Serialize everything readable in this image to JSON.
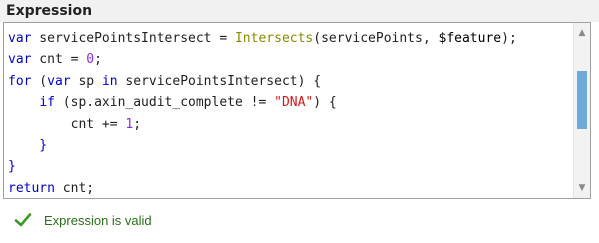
{
  "header": {
    "title": "Expression"
  },
  "editor": {
    "lines": [
      [
        {
          "t": "var",
          "c": "kw"
        },
        {
          "t": " servicePointsIntersect = "
        },
        {
          "t": "Intersects",
          "c": "fn"
        },
        {
          "t": "(servicePoints, "
        },
        {
          "t": "$feature",
          "c": "var"
        },
        {
          "t": ");"
        }
      ],
      [
        {
          "t": "var",
          "c": "kw"
        },
        {
          "t": " cnt = "
        },
        {
          "t": "0",
          "c": "num"
        },
        {
          "t": ";"
        }
      ],
      [
        {
          "t": "for",
          "c": "kw"
        },
        {
          "t": " ("
        },
        {
          "t": "var",
          "c": "kw"
        },
        {
          "t": " sp "
        },
        {
          "t": "in",
          "c": "kw"
        },
        {
          "t": " servicePointsIntersect) {"
        }
      ],
      [
        {
          "t": "    "
        },
        {
          "t": "if",
          "c": "kw"
        },
        {
          "t": " (sp.axin_audit_complete != "
        },
        {
          "t": "\"DNA\"",
          "c": "str"
        },
        {
          "t": ") {"
        }
      ],
      [
        {
          "t": "        cnt += "
        },
        {
          "t": "1",
          "c": "num"
        },
        {
          "t": ";"
        }
      ],
      [
        {
          "t": "    }",
          "c": "kw"
        }
      ],
      [
        {
          "t": "}",
          "c": "kw"
        }
      ],
      [
        {
          "t": "return",
          "c": "kw"
        },
        {
          "t": " cnt;"
        }
      ]
    ]
  },
  "scrollbar": {
    "up_icon": "scroll-up-arrow-icon",
    "down_icon": "scroll-down-arrow-icon",
    "thumb_color": "#6ea9d8"
  },
  "status": {
    "icon": "check-icon",
    "text": "Expression is valid",
    "color": "#2a6e18"
  }
}
